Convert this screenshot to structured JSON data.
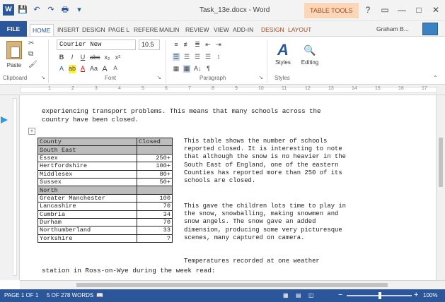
{
  "window": {
    "title": "Task_13e.docx - Word",
    "context_tab_group": "TABLE TOOLS",
    "help_label": "?",
    "controls": {
      "restore": "▭",
      "minimize": "—",
      "maximize": "□",
      "close": "✕"
    }
  },
  "quick_access": {
    "save_icon": "save-icon",
    "undo_icon": "undo-icon",
    "redo_icon": "redo-icon"
  },
  "ribbon_tabs": [
    "FILE",
    "HOME",
    "INSERT",
    "DESIGN",
    "PAGE L",
    "REFERE",
    "MAILIN",
    "REVIEW",
    "VIEW",
    "ADD-IN",
    "DESIGN",
    "LAYOUT"
  ],
  "user": {
    "name": "Graham B..."
  },
  "ribbon": {
    "clipboard": {
      "paste_label": "Paste",
      "group_label": "Clipboard"
    },
    "font": {
      "font_name": "Courier New",
      "font_size": "10.5",
      "bold": "B",
      "italic": "I",
      "underline": "U",
      "strike": "abc",
      "subscript": "x₂",
      "superscript": "x²",
      "text_effects": "A",
      "highlight": "ab",
      "font_color": "A",
      "change_case": "Aa",
      "grow": "A",
      "shrink": "A",
      "group_label": "Font"
    },
    "paragraph": {
      "show_marks": "¶",
      "sort": "A↓",
      "group_label": "Paragraph"
    },
    "styles": {
      "label": "Styles",
      "group_label": "Styles"
    },
    "editing": {
      "label": "Editing"
    }
  },
  "ruler_numbers": [
    "1",
    "2",
    "3",
    "4",
    "5",
    "6",
    "7",
    "8",
    "9",
    "10",
    "11",
    "12",
    "13",
    "14",
    "15",
    "16",
    "17"
  ],
  "document": {
    "para_top": [
      "experiencing transport problems. This means that many schools across the",
      "country have been closed."
    ],
    "table_header": [
      "County",
      "Closed"
    ],
    "table_rows": [
      {
        "county": "South East",
        "closed": "",
        "region": true
      },
      {
        "county": "Essex",
        "closed": "250+",
        "region": false
      },
      {
        "county": "Hertfordshire",
        "closed": "100+",
        "region": false
      },
      {
        "county": "Middlesex",
        "closed": "80+",
        "region": false
      },
      {
        "county": "Sussex",
        "closed": "50+",
        "region": false
      },
      {
        "county": "North",
        "closed": "",
        "region": true
      },
      {
        "county": "Greater Manchester",
        "closed": "100",
        "region": false
      },
      {
        "county": "Lancashire",
        "closed": "70",
        "region": false
      },
      {
        "county": "Cumbria",
        "closed": "34",
        "region": false
      },
      {
        "county": "Durham",
        "closed": "70",
        "region": false
      },
      {
        "county": "Northumberland",
        "closed": "33",
        "region": false
      },
      {
        "county": "Yorkshire",
        "closed": "?",
        "region": false
      }
    ],
    "side_para_1": [
      "This table shows the number of schools",
      "reported closed. It is interesting to note",
      "that although the snow is no heavier in the",
      "South East of England, one of the eastern",
      "Counties has reported more than 250 of its",
      "schools are closed."
    ],
    "side_para_2": [
      "This gave the children lots time to play in",
      "the snow, snowballing, making snowmen and",
      "snow angels. The snow gave an added",
      "dimension, producing some very picturesque",
      "scenes, many captured on camera."
    ],
    "side_para_3": "Temperatures recorded at one weather",
    "para_bottom": "station in Ross-on-Wye during the week read:"
  },
  "status_bar": {
    "page": "PAGE 1 OF 1",
    "words": "5 OF 278 WORDS",
    "zoom_minus": "−",
    "zoom_plus": "+",
    "zoom": "100%"
  },
  "colors": {
    "accent": "#2b579a",
    "table_tools": "#a4491a",
    "table_header_fill": "#bdbdbd"
  }
}
